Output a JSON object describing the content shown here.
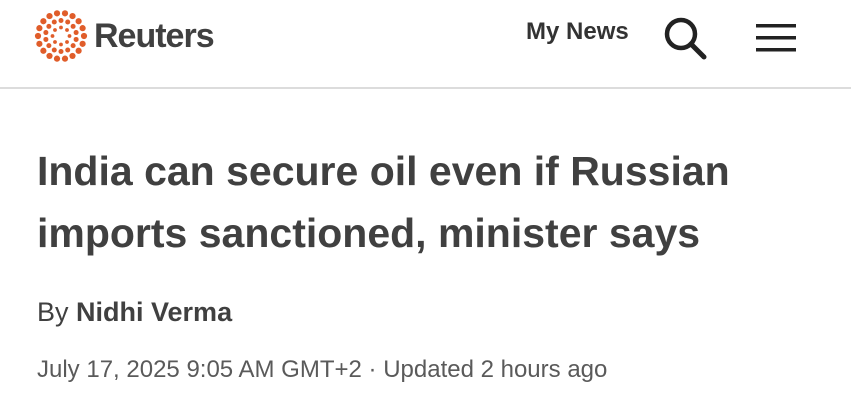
{
  "header": {
    "logo_text": "Reuters",
    "logo_icon": "reuters-dot-ring-icon",
    "my_news_label": "My News",
    "search_icon": "search-icon",
    "menu_icon": "hamburger-menu-icon",
    "brand_color": "#e05d2a"
  },
  "article": {
    "headline": "India can secure oil even if Russian imports sanctioned, minister says",
    "byline_prefix": "By",
    "author": "Nidhi Verma",
    "published": "July 17, 2025 9:05 AM GMT+2",
    "separator": "·",
    "updated": "Updated 2 hours ago"
  }
}
